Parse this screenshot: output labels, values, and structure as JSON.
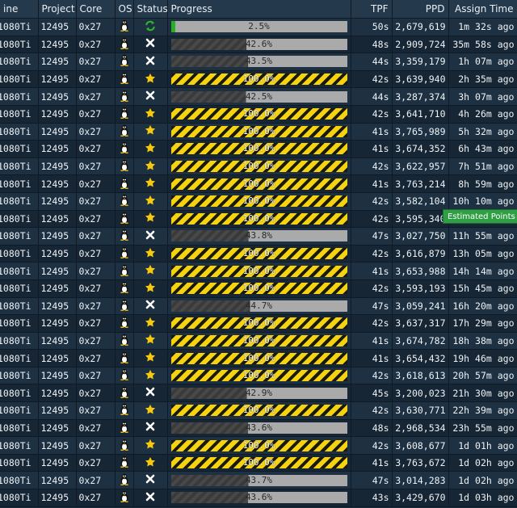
{
  "colors": {
    "done": "#f5d311",
    "active": "#27b024",
    "header_bg": "#24394c",
    "tooltip": "#2f9e44"
  },
  "headers": [
    "ine",
    "Project",
    "Core",
    "OS",
    "Status",
    "Progress",
    "TPF",
    "PPD",
    "Assign Time"
  ],
  "icons": {
    "os": "linux-tux-icon",
    "complete": "star-icon",
    "failed": "x-mark-icon",
    "running": "refresh-icon"
  },
  "tooltip": "Estimated Points Per Day",
  "rows": [
    {
      "name": "1080Ti",
      "project": "12495",
      "core": "0x27",
      "status": "running",
      "progress": 2.5,
      "progress_label": "2.5%",
      "tpf": "50s",
      "ppd": "2,679,619",
      "assign": "1m 32s ago"
    },
    {
      "name": "1080Ti",
      "project": "12495",
      "core": "0x27",
      "status": "failed",
      "progress": 42.6,
      "progress_label": "42.6%",
      "tpf": "48s",
      "ppd": "2,909,724",
      "assign": "35m 58s ago"
    },
    {
      "name": "1080Ti",
      "project": "12495",
      "core": "0x27",
      "status": "failed",
      "progress": 43.5,
      "progress_label": "43.5%",
      "tpf": "44s",
      "ppd": "3,359,179",
      "assign": "1h 07m ago"
    },
    {
      "name": "1080Ti",
      "project": "12495",
      "core": "0x27",
      "status": "complete",
      "progress": 100,
      "progress_label": "100.0%",
      "tpf": "42s",
      "ppd": "3,639,940",
      "assign": "2h 35m ago"
    },
    {
      "name": "1080Ti",
      "project": "12495",
      "core": "0x27",
      "status": "failed",
      "progress": 42.5,
      "progress_label": "42.5%",
      "tpf": "44s",
      "ppd": "3,287,374",
      "assign": "3h 07m ago"
    },
    {
      "name": "1080Ti",
      "project": "12495",
      "core": "0x27",
      "status": "complete",
      "progress": 100,
      "progress_label": "100.0%",
      "tpf": "42s",
      "ppd": "3,641,710",
      "assign": "4h 26m ago"
    },
    {
      "name": "1080Ti",
      "project": "12495",
      "core": "0x27",
      "status": "complete",
      "progress": 100,
      "progress_label": "100.0%",
      "tpf": "41s",
      "ppd": "3,765,989",
      "assign": "5h 32m ago"
    },
    {
      "name": "1080Ti",
      "project": "12495",
      "core": "0x27",
      "status": "complete",
      "progress": 100,
      "progress_label": "100.0%",
      "tpf": "41s",
      "ppd": "3,674,352",
      "assign": "6h 43m ago"
    },
    {
      "name": "1080Ti",
      "project": "12495",
      "core": "0x27",
      "status": "complete",
      "progress": 100,
      "progress_label": "100.0%",
      "tpf": "42s",
      "ppd": "3,622,957",
      "assign": "7h 51m ago"
    },
    {
      "name": "1080Ti",
      "project": "12495",
      "core": "0x27",
      "status": "complete",
      "progress": 100,
      "progress_label": "100.0%",
      "tpf": "41s",
      "ppd": "3,763,214",
      "assign": "8h 59m ago"
    },
    {
      "name": "1080Ti",
      "project": "12495",
      "core": "0x27",
      "status": "complete",
      "progress": 100,
      "progress_label": "100.0%",
      "tpf": "42s",
      "ppd": "3,582,104",
      "assign": "10h 10m ago"
    },
    {
      "name": "1080Ti",
      "project": "12495",
      "core": "0x27",
      "status": "complete",
      "progress": 100,
      "progress_label": "100.0%",
      "tpf": "42s",
      "ppd": "3,595,340",
      "assign": ""
    },
    {
      "name": "1080Ti",
      "project": "12495",
      "core": "0x27",
      "status": "failed",
      "progress": 43.8,
      "progress_label": "43.8%",
      "tpf": "47s",
      "ppd": "3,027,750",
      "assign": "11h 55m ago"
    },
    {
      "name": "1080Ti",
      "project": "12495",
      "core": "0x27",
      "status": "complete",
      "progress": 100,
      "progress_label": "100.0%",
      "tpf": "42s",
      "ppd": "3,616,879",
      "assign": "13h 05m ago"
    },
    {
      "name": "1080Ti",
      "project": "12495",
      "core": "0x27",
      "status": "complete",
      "progress": 100,
      "progress_label": "100.0%",
      "tpf": "41s",
      "ppd": "3,653,988",
      "assign": "14h 14m ago"
    },
    {
      "name": "1080Ti",
      "project": "12495",
      "core": "0x27",
      "status": "complete",
      "progress": 100,
      "progress_label": "100.0%",
      "tpf": "42s",
      "ppd": "3,593,193",
      "assign": "15h 45m ago"
    },
    {
      "name": "1080Ti",
      "project": "12495",
      "core": "0x27",
      "status": "failed",
      "progress": 44.7,
      "progress_label": "44.7%",
      "tpf": "47s",
      "ppd": "3,059,241",
      "assign": "16h 20m ago"
    },
    {
      "name": "1080Ti",
      "project": "12495",
      "core": "0x27",
      "status": "complete",
      "progress": 100,
      "progress_label": "100.0%",
      "tpf": "42s",
      "ppd": "3,637,317",
      "assign": "17h 29m ago"
    },
    {
      "name": "1080Ti",
      "project": "12495",
      "core": "0x27",
      "status": "complete",
      "progress": 100,
      "progress_label": "100.0%",
      "tpf": "41s",
      "ppd": "3,674,782",
      "assign": "18h 38m ago"
    },
    {
      "name": "1080Ti",
      "project": "12495",
      "core": "0x27",
      "status": "complete",
      "progress": 100,
      "progress_label": "100.0%",
      "tpf": "41s",
      "ppd": "3,654,432",
      "assign": "19h 46m ago"
    },
    {
      "name": "1080Ti",
      "project": "12495",
      "core": "0x27",
      "status": "complete",
      "progress": 100,
      "progress_label": "100.0%",
      "tpf": "42s",
      "ppd": "3,618,613",
      "assign": "20h 57m ago"
    },
    {
      "name": "1080Ti",
      "project": "12495",
      "core": "0x27",
      "status": "failed",
      "progress": 42.9,
      "progress_label": "42.9%",
      "tpf": "45s",
      "ppd": "3,200,023",
      "assign": "21h 30m ago"
    },
    {
      "name": "1080Ti",
      "project": "12495",
      "core": "0x27",
      "status": "complete",
      "progress": 100,
      "progress_label": "100.0%",
      "tpf": "42s",
      "ppd": "3,630,771",
      "assign": "22h 39m ago"
    },
    {
      "name": "1080Ti",
      "project": "12495",
      "core": "0x27",
      "status": "failed",
      "progress": 43.6,
      "progress_label": "43.6%",
      "tpf": "48s",
      "ppd": "2,968,534",
      "assign": "23h 55m ago"
    },
    {
      "name": "1080Ti",
      "project": "12495",
      "core": "0x27",
      "status": "complete",
      "progress": 100,
      "progress_label": "100.0%",
      "tpf": "42s",
      "ppd": "3,608,677",
      "assign": "1d 01h ago"
    },
    {
      "name": "1080Ti",
      "project": "12495",
      "core": "0x27",
      "status": "complete",
      "progress": 100,
      "progress_label": "100.0%",
      "tpf": "41s",
      "ppd": "3,763,672",
      "assign": "1d 02h ago"
    },
    {
      "name": "1080Ti",
      "project": "12495",
      "core": "0x27",
      "status": "failed",
      "progress": 43.7,
      "progress_label": "43.7%",
      "tpf": "47s",
      "ppd": "3,014,283",
      "assign": "1d 02h ago"
    },
    {
      "name": "1080Ti",
      "project": "12495",
      "core": "0x27",
      "status": "failed",
      "progress": 43.6,
      "progress_label": "43.6%",
      "tpf": "43s",
      "ppd": "3,429,670",
      "assign": "1d 03h ago"
    }
  ]
}
